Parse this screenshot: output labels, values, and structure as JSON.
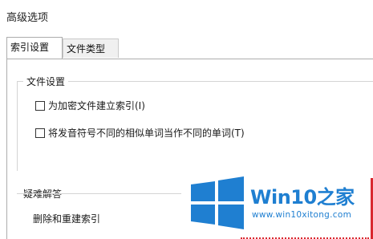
{
  "window": {
    "title": "高级选项"
  },
  "tabs": [
    {
      "label": "索引设置",
      "active": true
    },
    {
      "label": "文件类型",
      "active": false
    }
  ],
  "file_settings": {
    "label": "文件设置",
    "options": [
      {
        "label": "为加密文件建立索引(I)",
        "checked": false
      },
      {
        "label": "将发音符号不同的相似单词当作不同的单词(T)",
        "checked": false
      }
    ]
  },
  "troubleshooting": {
    "label": "疑难解答",
    "rebuild_text": "删除和重建索引"
  },
  "watermark": {
    "brand": "Win10",
    "brand_suffix": "之家",
    "url": "www.win10xitong.com",
    "logo_icon": "windows-logo-icon",
    "color": "#1f7fd1"
  },
  "accent": {
    "red": "#d9282f"
  }
}
